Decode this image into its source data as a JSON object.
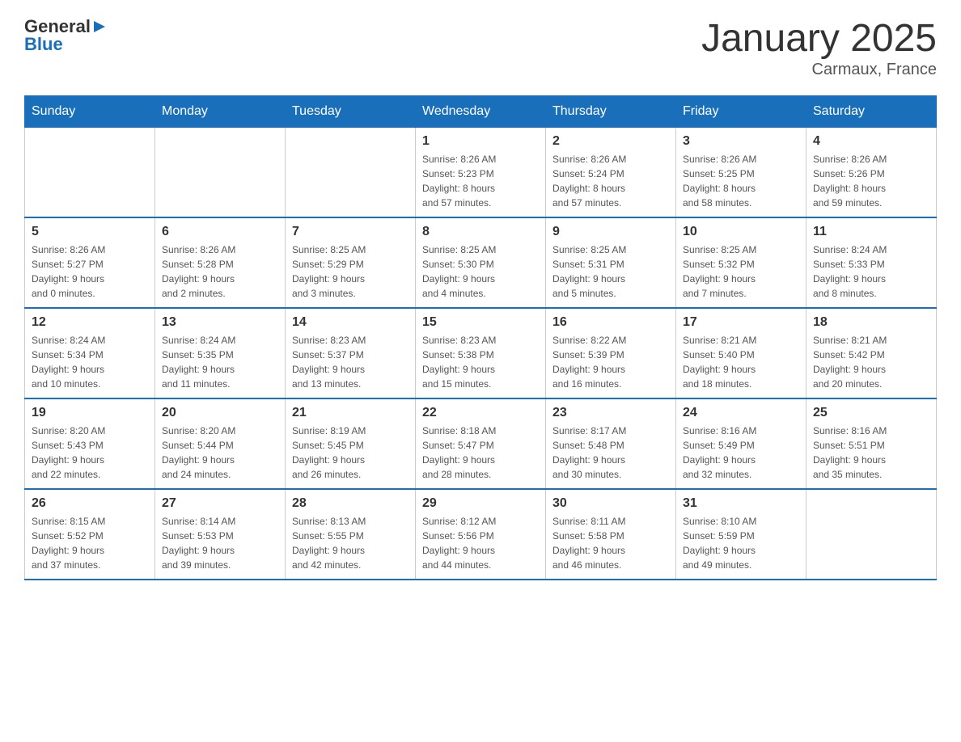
{
  "header": {
    "logo": {
      "general": "General",
      "blue": "Blue"
    },
    "title": "January 2025",
    "location": "Carmaux, France"
  },
  "calendar": {
    "days_of_week": [
      "Sunday",
      "Monday",
      "Tuesday",
      "Wednesday",
      "Thursday",
      "Friday",
      "Saturday"
    ],
    "weeks": [
      [
        {
          "day": "",
          "info": ""
        },
        {
          "day": "",
          "info": ""
        },
        {
          "day": "",
          "info": ""
        },
        {
          "day": "1",
          "info": "Sunrise: 8:26 AM\nSunset: 5:23 PM\nDaylight: 8 hours\nand 57 minutes."
        },
        {
          "day": "2",
          "info": "Sunrise: 8:26 AM\nSunset: 5:24 PM\nDaylight: 8 hours\nand 57 minutes."
        },
        {
          "day": "3",
          "info": "Sunrise: 8:26 AM\nSunset: 5:25 PM\nDaylight: 8 hours\nand 58 minutes."
        },
        {
          "day": "4",
          "info": "Sunrise: 8:26 AM\nSunset: 5:26 PM\nDaylight: 8 hours\nand 59 minutes."
        }
      ],
      [
        {
          "day": "5",
          "info": "Sunrise: 8:26 AM\nSunset: 5:27 PM\nDaylight: 9 hours\nand 0 minutes."
        },
        {
          "day": "6",
          "info": "Sunrise: 8:26 AM\nSunset: 5:28 PM\nDaylight: 9 hours\nand 2 minutes."
        },
        {
          "day": "7",
          "info": "Sunrise: 8:25 AM\nSunset: 5:29 PM\nDaylight: 9 hours\nand 3 minutes."
        },
        {
          "day": "8",
          "info": "Sunrise: 8:25 AM\nSunset: 5:30 PM\nDaylight: 9 hours\nand 4 minutes."
        },
        {
          "day": "9",
          "info": "Sunrise: 8:25 AM\nSunset: 5:31 PM\nDaylight: 9 hours\nand 5 minutes."
        },
        {
          "day": "10",
          "info": "Sunrise: 8:25 AM\nSunset: 5:32 PM\nDaylight: 9 hours\nand 7 minutes."
        },
        {
          "day": "11",
          "info": "Sunrise: 8:24 AM\nSunset: 5:33 PM\nDaylight: 9 hours\nand 8 minutes."
        }
      ],
      [
        {
          "day": "12",
          "info": "Sunrise: 8:24 AM\nSunset: 5:34 PM\nDaylight: 9 hours\nand 10 minutes."
        },
        {
          "day": "13",
          "info": "Sunrise: 8:24 AM\nSunset: 5:35 PM\nDaylight: 9 hours\nand 11 minutes."
        },
        {
          "day": "14",
          "info": "Sunrise: 8:23 AM\nSunset: 5:37 PM\nDaylight: 9 hours\nand 13 minutes."
        },
        {
          "day": "15",
          "info": "Sunrise: 8:23 AM\nSunset: 5:38 PM\nDaylight: 9 hours\nand 15 minutes."
        },
        {
          "day": "16",
          "info": "Sunrise: 8:22 AM\nSunset: 5:39 PM\nDaylight: 9 hours\nand 16 minutes."
        },
        {
          "day": "17",
          "info": "Sunrise: 8:21 AM\nSunset: 5:40 PM\nDaylight: 9 hours\nand 18 minutes."
        },
        {
          "day": "18",
          "info": "Sunrise: 8:21 AM\nSunset: 5:42 PM\nDaylight: 9 hours\nand 20 minutes."
        }
      ],
      [
        {
          "day": "19",
          "info": "Sunrise: 8:20 AM\nSunset: 5:43 PM\nDaylight: 9 hours\nand 22 minutes."
        },
        {
          "day": "20",
          "info": "Sunrise: 8:20 AM\nSunset: 5:44 PM\nDaylight: 9 hours\nand 24 minutes."
        },
        {
          "day": "21",
          "info": "Sunrise: 8:19 AM\nSunset: 5:45 PM\nDaylight: 9 hours\nand 26 minutes."
        },
        {
          "day": "22",
          "info": "Sunrise: 8:18 AM\nSunset: 5:47 PM\nDaylight: 9 hours\nand 28 minutes."
        },
        {
          "day": "23",
          "info": "Sunrise: 8:17 AM\nSunset: 5:48 PM\nDaylight: 9 hours\nand 30 minutes."
        },
        {
          "day": "24",
          "info": "Sunrise: 8:16 AM\nSunset: 5:49 PM\nDaylight: 9 hours\nand 32 minutes."
        },
        {
          "day": "25",
          "info": "Sunrise: 8:16 AM\nSunset: 5:51 PM\nDaylight: 9 hours\nand 35 minutes."
        }
      ],
      [
        {
          "day": "26",
          "info": "Sunrise: 8:15 AM\nSunset: 5:52 PM\nDaylight: 9 hours\nand 37 minutes."
        },
        {
          "day": "27",
          "info": "Sunrise: 8:14 AM\nSunset: 5:53 PM\nDaylight: 9 hours\nand 39 minutes."
        },
        {
          "day": "28",
          "info": "Sunrise: 8:13 AM\nSunset: 5:55 PM\nDaylight: 9 hours\nand 42 minutes."
        },
        {
          "day": "29",
          "info": "Sunrise: 8:12 AM\nSunset: 5:56 PM\nDaylight: 9 hours\nand 44 minutes."
        },
        {
          "day": "30",
          "info": "Sunrise: 8:11 AM\nSunset: 5:58 PM\nDaylight: 9 hours\nand 46 minutes."
        },
        {
          "day": "31",
          "info": "Sunrise: 8:10 AM\nSunset: 5:59 PM\nDaylight: 9 hours\nand 49 minutes."
        },
        {
          "day": "",
          "info": ""
        }
      ]
    ]
  }
}
